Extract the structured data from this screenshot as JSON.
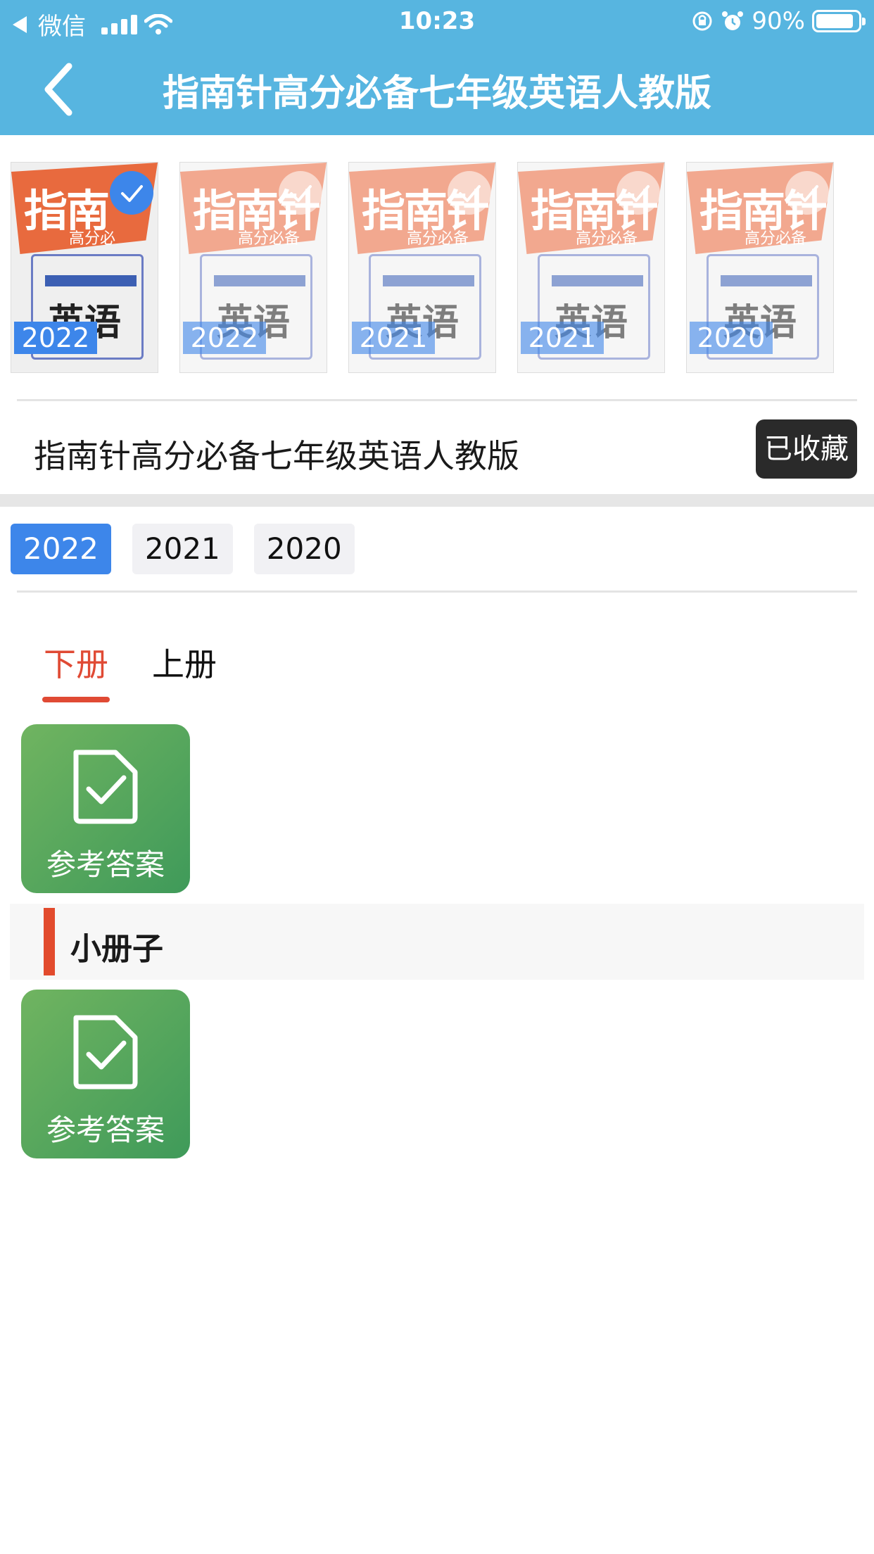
{
  "status_bar": {
    "carrier": "微信",
    "time": "10:23",
    "battery": "90%",
    "battery_level": 0.9
  },
  "header": {
    "title": "指南针高分必备七年级英语人教版"
  },
  "covers": [
    {
      "brand": "指南",
      "subbrand": "高分必",
      "subject": "英语",
      "year": "2022",
      "selected": true
    },
    {
      "brand": "指南针",
      "subbrand": "高分必备",
      "subject": "英语",
      "year": "2022",
      "selected": false
    },
    {
      "brand": "指南针",
      "subbrand": "高分必备",
      "subject": "英语",
      "year": "2021",
      "selected": false
    },
    {
      "brand": "指南针",
      "subbrand": "高分必备",
      "subject": "英语",
      "year": "2021",
      "selected": false
    },
    {
      "brand": "指南针",
      "subbrand": "高分必备",
      "subject": "英语",
      "year": "2020",
      "selected": false
    }
  ],
  "book": {
    "title": "指南针高分必备七年级英语人教版",
    "favorite_label": "已收藏"
  },
  "years": {
    "items": [
      "2022",
      "2021",
      "2020"
    ],
    "active": "2022"
  },
  "tabs": {
    "items": [
      "下册",
      "上册"
    ],
    "active": "下册"
  },
  "answers": {
    "main_label": "参考答案",
    "section_title": "小册子",
    "booklet_label": "参考答案"
  },
  "colors": {
    "header": "#57b5e0",
    "accent_blue": "#3d86ea",
    "tab_active": "#e04a34",
    "tile_green": "#4fa55a"
  }
}
